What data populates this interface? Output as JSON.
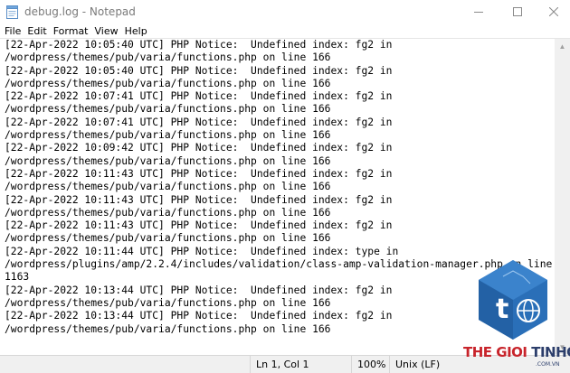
{
  "window": {
    "title": "debug.log - Notepad"
  },
  "menu": [
    "File",
    "Edit",
    "Format",
    "View",
    "Help"
  ],
  "content": {
    "lines": [
      "[22-Apr-2022 10:05:40 UTC] PHP Notice:  Undefined index: fg2 in",
      "/wordpress/themes/pub/varia/functions.php on line 166",
      "[22-Apr-2022 10:05:40 UTC] PHP Notice:  Undefined index: fg2 in",
      "/wordpress/themes/pub/varia/functions.php on line 166",
      "[22-Apr-2022 10:07:41 UTC] PHP Notice:  Undefined index: fg2 in",
      "/wordpress/themes/pub/varia/functions.php on line 166",
      "[22-Apr-2022 10:07:41 UTC] PHP Notice:  Undefined index: fg2 in",
      "/wordpress/themes/pub/varia/functions.php on line 166",
      "[22-Apr-2022 10:09:42 UTC] PHP Notice:  Undefined index: fg2 in",
      "/wordpress/themes/pub/varia/functions.php on line 166",
      "[22-Apr-2022 10:11:43 UTC] PHP Notice:  Undefined index: fg2 in",
      "/wordpress/themes/pub/varia/functions.php on line 166",
      "[22-Apr-2022 10:11:43 UTC] PHP Notice:  Undefined index: fg2 in",
      "/wordpress/themes/pub/varia/functions.php on line 166",
      "[22-Apr-2022 10:11:43 UTC] PHP Notice:  Undefined index: fg2 in",
      "/wordpress/themes/pub/varia/functions.php on line 166",
      "[22-Apr-2022 10:11:44 UTC] PHP Notice:  Undefined index: type in",
      "/wordpress/plugins/amp/2.2.4/includes/validation/class-amp-validation-manager.php on line",
      "1163",
      "[22-Apr-2022 10:13:44 UTC] PHP Notice:  Undefined index: fg2 in",
      "/wordpress/themes/pub/varia/functions.php on line 166",
      "[22-Apr-2022 10:13:44 UTC] PHP Notice:  Undefined index: fg2 in",
      "/wordpress/themes/pub/varia/functions.php on line 166"
    ]
  },
  "status": {
    "position": "Ln 1, Col 1",
    "zoom": "100%",
    "line_ending": "Unix (LF)"
  },
  "watermark": {
    "brand_red": "THE GIOI",
    "brand_dark": "TINHOC",
    "domain": ".COM.VN"
  },
  "icons": {
    "app": "notepad-icon",
    "minimize": "minimize-icon",
    "maximize": "maximize-icon",
    "close": "close-icon"
  },
  "colors": {
    "title_text": "#7a7a7a",
    "statusbar_bg": "#f0f0f0",
    "logo_blue": "#2a6fb8",
    "logo_red": "#c8242b"
  }
}
